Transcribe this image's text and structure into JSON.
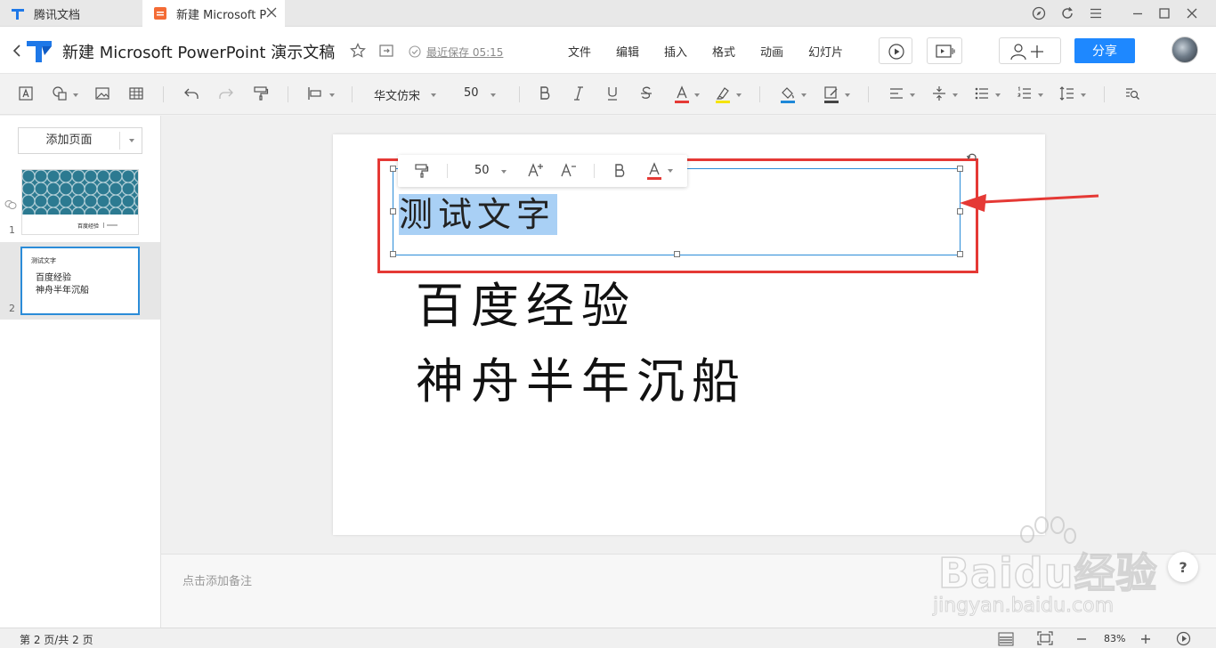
{
  "browser": {
    "tab1_label": "腾讯文档",
    "tab2_label": "新建 Microsoft P"
  },
  "header": {
    "doc_title": "新建 Microsoft PowerPoint 演示文稿",
    "save_status": "最近保存 05:15",
    "menu": [
      "文件",
      "编辑",
      "插入",
      "格式",
      "动画",
      "幻灯片"
    ],
    "share_label": "分享"
  },
  "toolbar": {
    "font_name": "华文仿宋",
    "font_size": "50"
  },
  "sidebar": {
    "add_page_label": "添加页面",
    "slides": [
      {
        "number": "1",
        "caption": "百度经验"
      },
      {
        "number": "2",
        "title": "测试文字",
        "lines": [
          "百度经验",
          "神舟半年沉船"
        ]
      }
    ]
  },
  "slide": {
    "title_text": "测试文字",
    "body_lines": [
      "百度经验",
      "神舟半年沉船"
    ],
    "floating_font_size": "50"
  },
  "notes": {
    "placeholder": "点击添加备注"
  },
  "status": {
    "page_info": "第 2 页/共 2 页",
    "zoom": "83%"
  },
  "watermark": {
    "text": "Baidu经验",
    "url": "jingyan.baidu.com"
  },
  "colors": {
    "accent": "#1e88ff",
    "selection": "#a9d0f5",
    "annotation_red": "#e53935",
    "text_color_underline": "#e53935",
    "highlight_underline": "#f5e400",
    "fill_underline": "#1e88d8"
  },
  "help_label": "?"
}
